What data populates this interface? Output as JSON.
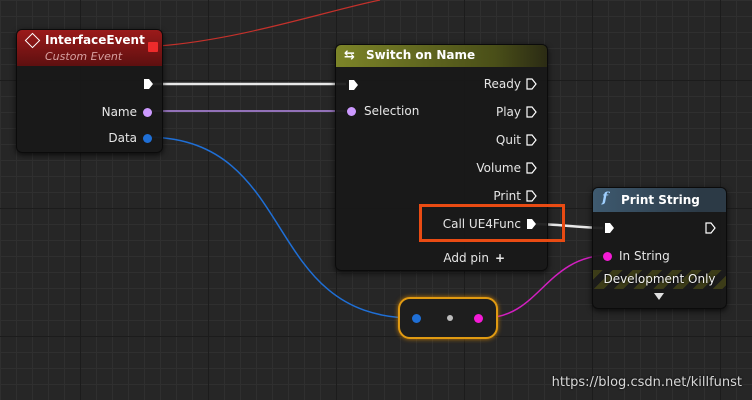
{
  "interface_event": {
    "title": "InterfaceEvent",
    "subtitle": "Custom Event",
    "pins": {
      "name": "Name",
      "data": "Data"
    }
  },
  "switch_node": {
    "title": "Switch on Name",
    "input": "Selection",
    "outputs": [
      "Ready",
      "Play",
      "Quit",
      "Volume",
      "Print",
      "Call UE4Func"
    ],
    "add_pin": "Add pin",
    "add_icon": "+"
  },
  "print_string": {
    "title": "Print String",
    "input": "In String",
    "dev_only": "Development Only"
  },
  "watermark": "https://blog.csdn.net/killfunst",
  "colors": {
    "event_header": "#8a1414",
    "switch_header": "#6c7322",
    "print_header": "#3a5468",
    "name_pin": "#cc99ff",
    "struct_pin": "#1f6fd6",
    "string_pin": "#f41bd6",
    "highlight": "#e94b13",
    "reroute_border": "#e09a12"
  }
}
